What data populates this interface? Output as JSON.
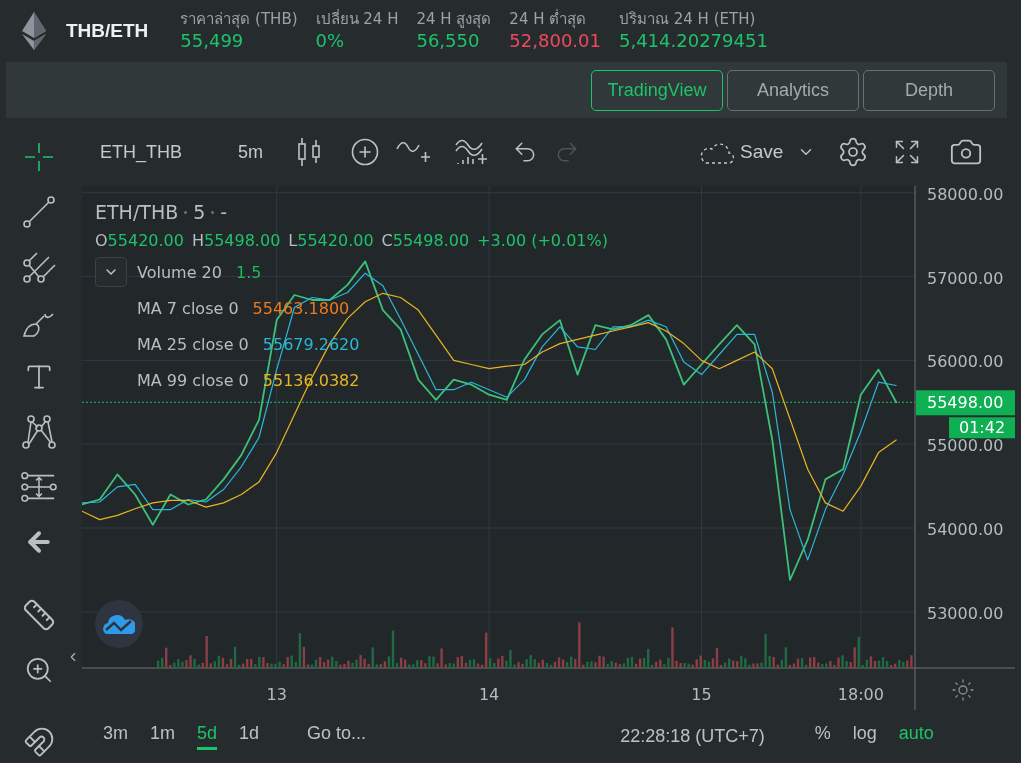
{
  "header": {
    "pair": "THB/ETH",
    "stats": [
      {
        "label": "ราคาล่าสุด (THB)",
        "value": "55,499",
        "color": "#1ec26a"
      },
      {
        "label": "เปลี่ยน 24 H",
        "value": "0%",
        "color": "#1ec26a"
      },
      {
        "label": "24 H สูงสุด",
        "value": "56,550",
        "color": "#1ec26a"
      },
      {
        "label": "24 H ต่ำสุด",
        "value": "52,800.01",
        "color": "#f0495c"
      },
      {
        "label": "ปริมาณ 24 H (ETH)",
        "value": "5,414.20279451",
        "color": "#1ec26a"
      }
    ]
  },
  "view_tabs": [
    {
      "label": "TradingView",
      "selected": true
    },
    {
      "label": "Analytics",
      "selected": false
    },
    {
      "label": "Depth",
      "selected": false
    }
  ],
  "drawing_tools": [
    {
      "kind": "crosshair",
      "selected": true
    },
    {
      "kind": "trendline",
      "selected": false
    },
    {
      "kind": "pitchfork",
      "selected": false
    },
    {
      "kind": "brush",
      "selected": false
    },
    {
      "kind": "text",
      "selected": false
    },
    {
      "kind": "pattern",
      "selected": false
    },
    {
      "kind": "measure",
      "selected": false
    },
    {
      "kind": "back",
      "selected": false
    },
    {
      "kind": "ruler",
      "selected": false
    },
    {
      "kind": "zoom",
      "selected": false
    },
    {
      "kind": "magnet",
      "selected": false
    }
  ],
  "toolbar": {
    "symbol": "ETH_THB",
    "interval": "5m",
    "save_label": "Save",
    "redo_disabled": true
  },
  "legend": {
    "title": [
      "ETH/THB",
      "5",
      "-"
    ],
    "ohlc": [
      {
        "label": "O",
        "value": "55420.00"
      },
      {
        "label": "H",
        "value": "55498.00"
      },
      {
        "label": "L",
        "value": "55420.00"
      },
      {
        "label": "C",
        "value": "55498.00"
      }
    ],
    "change": "+3.00 (+0.01%)",
    "indicators": [
      {
        "name": "Volume 20",
        "value": "1.5",
        "color": "#1db85a",
        "has_toggle": true
      },
      {
        "name": "MA 7 close 0",
        "value": "55463.1800",
        "color": "#f07a1a",
        "has_toggle": false
      },
      {
        "name": "MA 25 close 0",
        "value": "55679.2620",
        "color": "#2bb8d8",
        "has_toggle": false
      },
      {
        "name": "MA 99 close 0",
        "value": "55136.0382",
        "color": "#e8b423",
        "has_toggle": false
      }
    ]
  },
  "chart": {
    "last_price": "55498.00",
    "countdown": "01:42",
    "chart_data": {
      "type": "line",
      "categories": [
        null,
        null,
        null,
        null,
        null,
        null,
        null,
        null,
        null,
        null,
        null,
        "13",
        null,
        null,
        null,
        null,
        null,
        null,
        null,
        null,
        null,
        null,
        null,
        "14",
        null,
        null,
        null,
        null,
        null,
        null,
        null,
        null,
        null,
        null,
        null,
        "15",
        null,
        null,
        null,
        null,
        null,
        null,
        null,
        null,
        "18:00",
        null,
        null
      ],
      "series": [
        {
          "color": "#3cc07a",
          "values": [
            54280,
            54340,
            54640,
            54400,
            54040,
            54400,
            54280,
            54340,
            54580,
            54870,
            55290,
            56480,
            56780,
            56720,
            56720,
            56900,
            57180,
            56600,
            56370,
            55770,
            55530,
            55770,
            55710,
            55590,
            55530,
            56010,
            56310,
            56480,
            55830,
            56420,
            56370,
            56420,
            56540,
            56250,
            55710,
            55950,
            56190,
            56420,
            56190,
            55050,
            53380,
            53860,
            54580,
            54700,
            55590,
            55890,
            55500
          ]
        },
        {
          "color": "#2bb8d8",
          "values": [
            54300,
            54310,
            54490,
            54520,
            54220,
            54220,
            54340,
            54310,
            54460,
            54730,
            55080,
            55890,
            56630,
            56750,
            56720,
            56810,
            57040,
            56890,
            56490,
            56070,
            55650,
            55650,
            55740,
            55650,
            55560,
            55770,
            56160,
            56400,
            56160,
            56130,
            56400,
            56400,
            56480,
            56400,
            55980,
            55830,
            56070,
            56310,
            56310,
            55620,
            54220,
            53620,
            54220,
            54640,
            55150,
            55740,
            55700
          ]
        },
        {
          "color": "#e8b423",
          "values": [
            54200,
            54100,
            54150,
            54230,
            54300,
            54330,
            54330,
            54250,
            54300,
            54400,
            54550,
            54900,
            55350,
            55800,
            56200,
            56500,
            56700,
            56800,
            56750,
            56600,
            56300,
            56000,
            55950,
            55900,
            55930,
            55950,
            56100,
            56200,
            56250,
            56300,
            56350,
            56400,
            56450,
            56350,
            56200,
            56000,
            55900,
            56000,
            56100,
            55900,
            55300,
            54700,
            54300,
            54200,
            54500,
            54900,
            55050
          ]
        }
      ],
      "grid": true,
      "ylim": [
        52330,
        58080
      ],
      "yticks": [
        {
          "value": 53000,
          "label": "53000.00"
        },
        {
          "value": 54000,
          "label": "54000.00"
        },
        {
          "value": 55000,
          "label": "55000.00"
        },
        {
          "value": 56000,
          "label": "56000.00"
        },
        {
          "value": 57000,
          "label": "57000.00"
        },
        {
          "value": 58000,
          "label": "58000.00"
        }
      ]
    }
  },
  "bottom_bar": {
    "ranges": [
      {
        "label": "3m",
        "selected": false
      },
      {
        "label": "1m",
        "selected": false
      },
      {
        "label": "5d",
        "selected": true
      },
      {
        "label": "1d",
        "selected": false
      }
    ],
    "goto": "Go to...",
    "clock": "22:28:18 (UTC+7)",
    "scale_options": [
      {
        "label": "%",
        "selected": false
      },
      {
        "label": "log",
        "selected": false
      },
      {
        "label": "auto",
        "selected": true
      }
    ]
  }
}
